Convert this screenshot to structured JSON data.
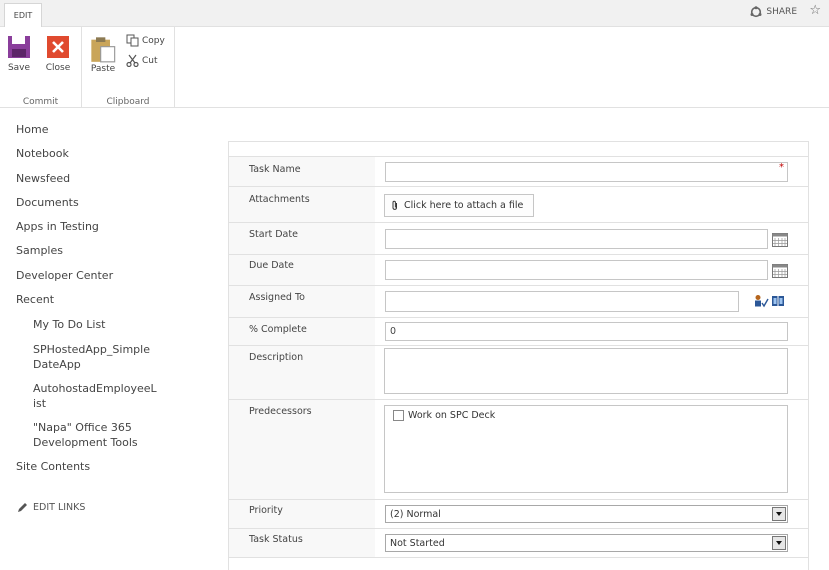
{
  "ribbon": {
    "tab_label": "EDIT",
    "share_label": "SHARE",
    "groups": {
      "commit": {
        "label": "Commit",
        "save_label": "Save",
        "close_label": "Close"
      },
      "clipboard": {
        "label": "Clipboard",
        "paste_label": "Paste",
        "copy_label": "Copy",
        "cut_label": "Cut"
      }
    }
  },
  "nav": {
    "items": [
      "Home",
      "Notebook",
      "Newsfeed",
      "Documents",
      "Apps in Testing",
      "Samples",
      "Developer Center",
      "Recent"
    ],
    "recent": [
      "My To Do List",
      "SPHostedApp_SimpleDateApp",
      "AutohostadEmployeeList",
      "\"Napa\" Office 365 Development Tools"
    ],
    "site_contents": "Site Contents",
    "edit_links": "EDIT LINKS"
  },
  "form": {
    "task_name": {
      "label": "Task Name",
      "value": "",
      "required_mark": "*"
    },
    "attachments": {
      "label": "Attachments",
      "button_label": "Click here to attach a file"
    },
    "start_date": {
      "label": "Start Date",
      "value": ""
    },
    "due_date": {
      "label": "Due Date",
      "value": ""
    },
    "assigned_to": {
      "label": "Assigned To",
      "value": ""
    },
    "percent_complete": {
      "label": "% Complete",
      "value": "0"
    },
    "description": {
      "label": "Description",
      "value": ""
    },
    "predecessors": {
      "label": "Predecessors",
      "options": [
        "Work on SPC Deck"
      ]
    },
    "priority": {
      "label": "Priority",
      "value": "(2) Normal"
    },
    "task_status": {
      "label": "Task Status",
      "value": "Not Started"
    }
  },
  "colors": {
    "save_icon": "#8a3e9b",
    "close_icon": "#e04a2f",
    "required": "#bf0000",
    "people_icon": "#2b5797"
  }
}
